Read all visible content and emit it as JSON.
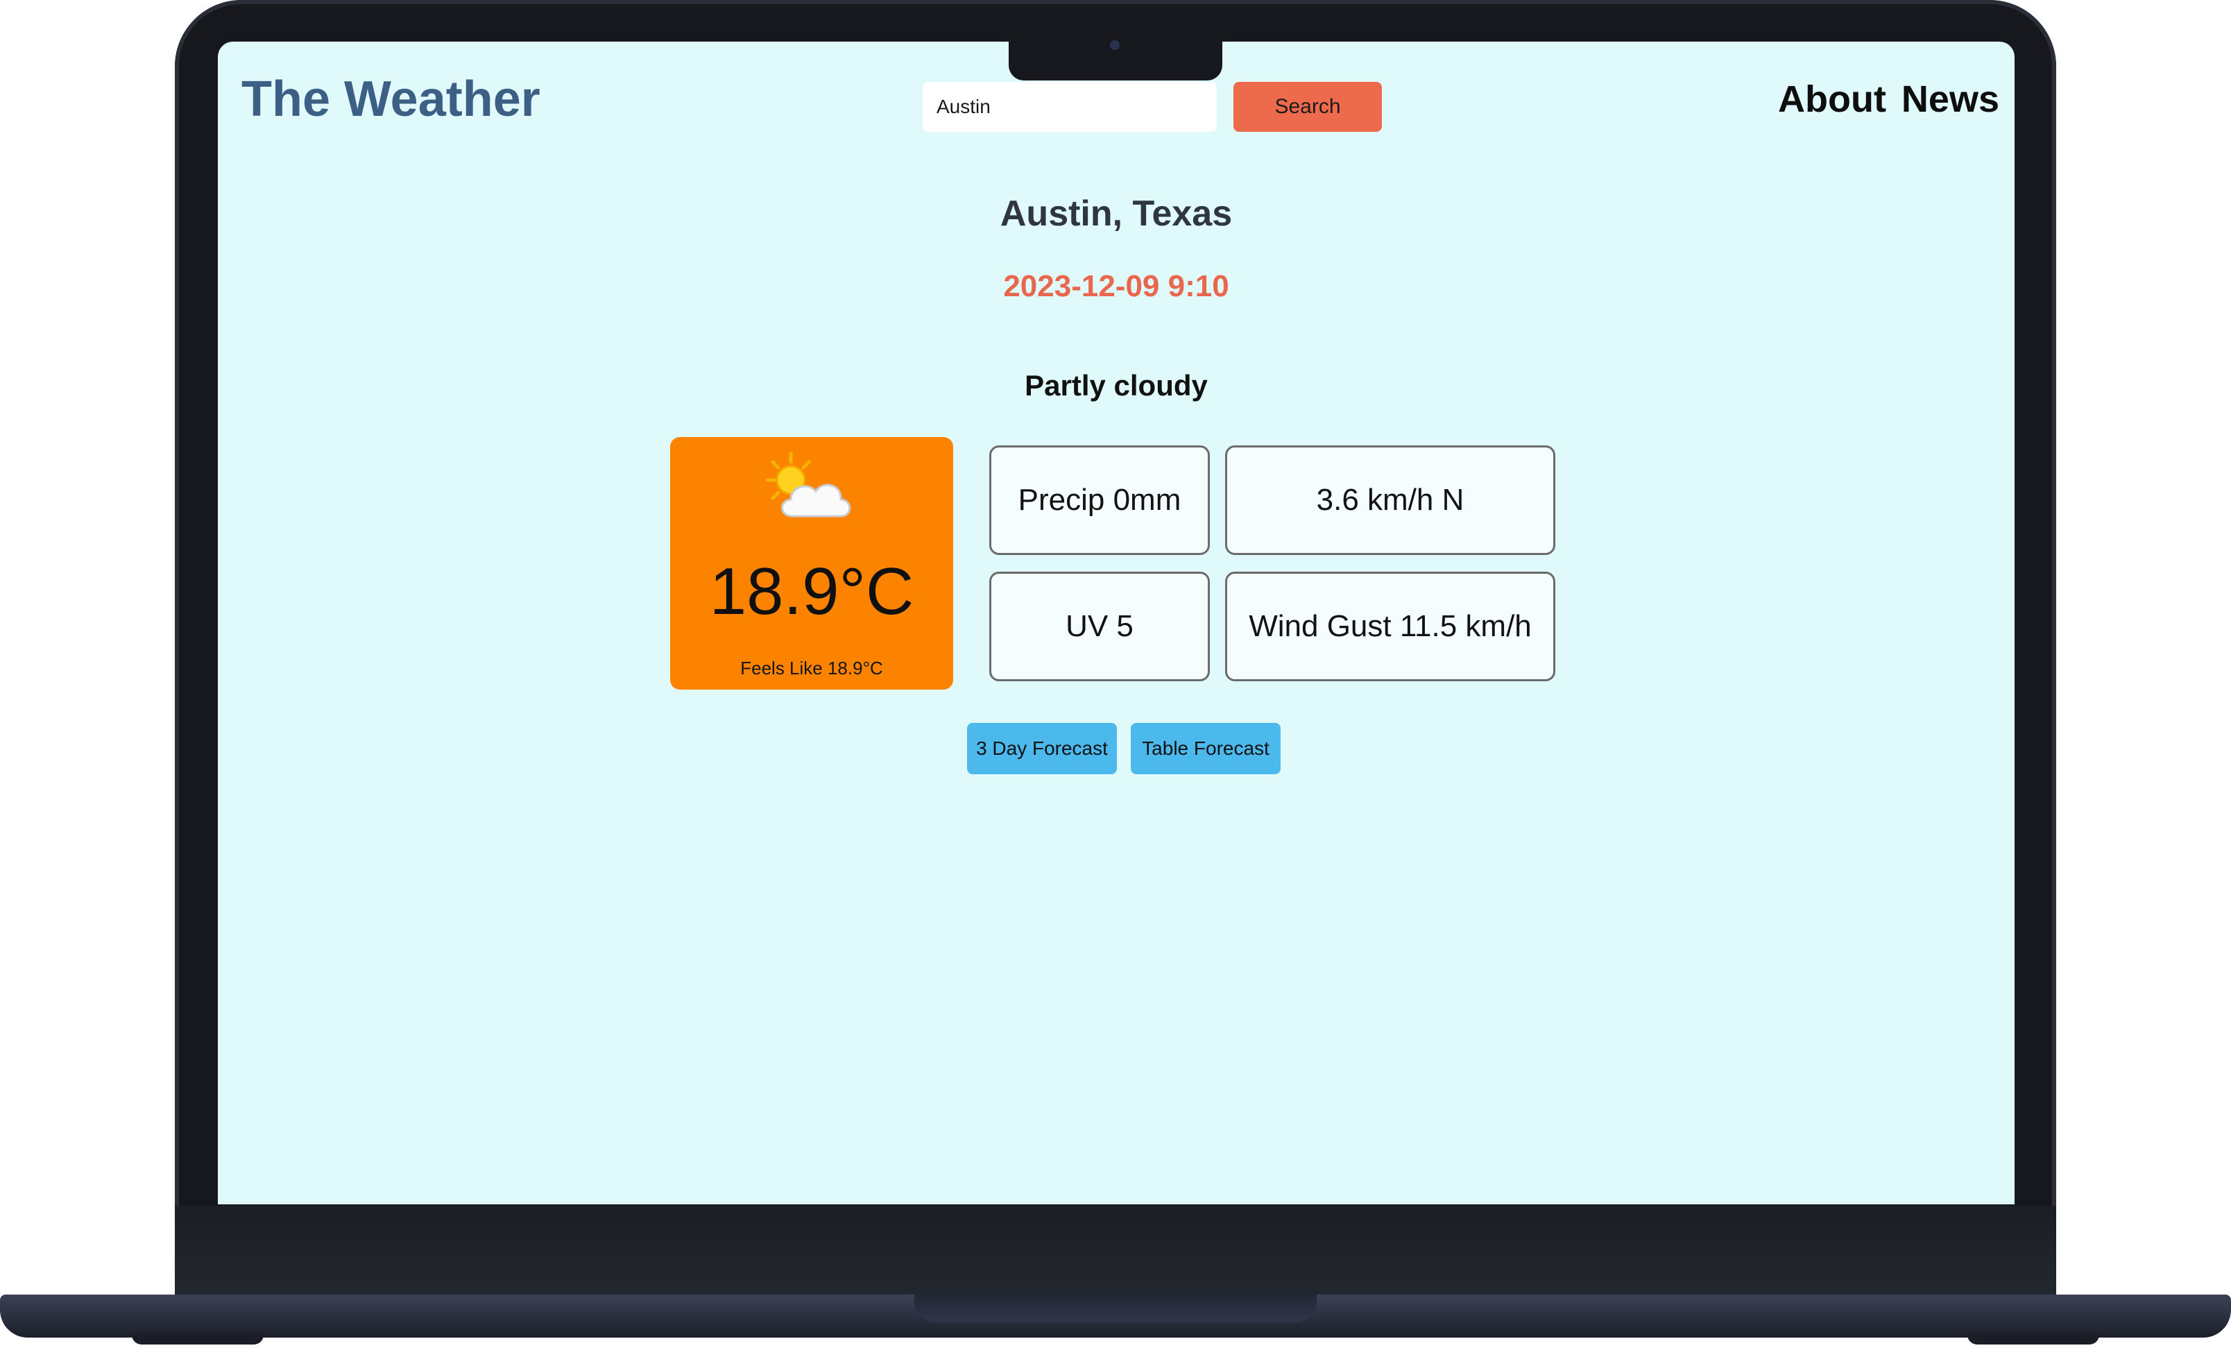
{
  "app": {
    "brand": "The Weather"
  },
  "search": {
    "value": "Austin",
    "button_label": "Search"
  },
  "nav": {
    "items": [
      {
        "label": "About"
      },
      {
        "label": "News"
      }
    ]
  },
  "location": {
    "title": "Austin, Texas",
    "datetime": "2023-12-09 9:10"
  },
  "current": {
    "condition": "Partly cloudy",
    "icon": "partly-cloudy-icon",
    "temperature": "18.9°C",
    "feels_like": "Feels Like 18.9°C",
    "precip": "Precip 0mm",
    "wind": "3.6 km/h N",
    "uv": "UV 5",
    "wind_gust": "Wind Gust 11.5 km/h"
  },
  "forecast_buttons": {
    "three_day": "3 Day Forecast",
    "table": "Table Forecast"
  },
  "colors": {
    "screen_bg": "#e0fafb",
    "brand": "#3c5f85",
    "search_button": "#ee6a4d",
    "datetime": "#e8674d",
    "temp_card": "#fb8300",
    "forecast_button": "#4cb9ec"
  }
}
